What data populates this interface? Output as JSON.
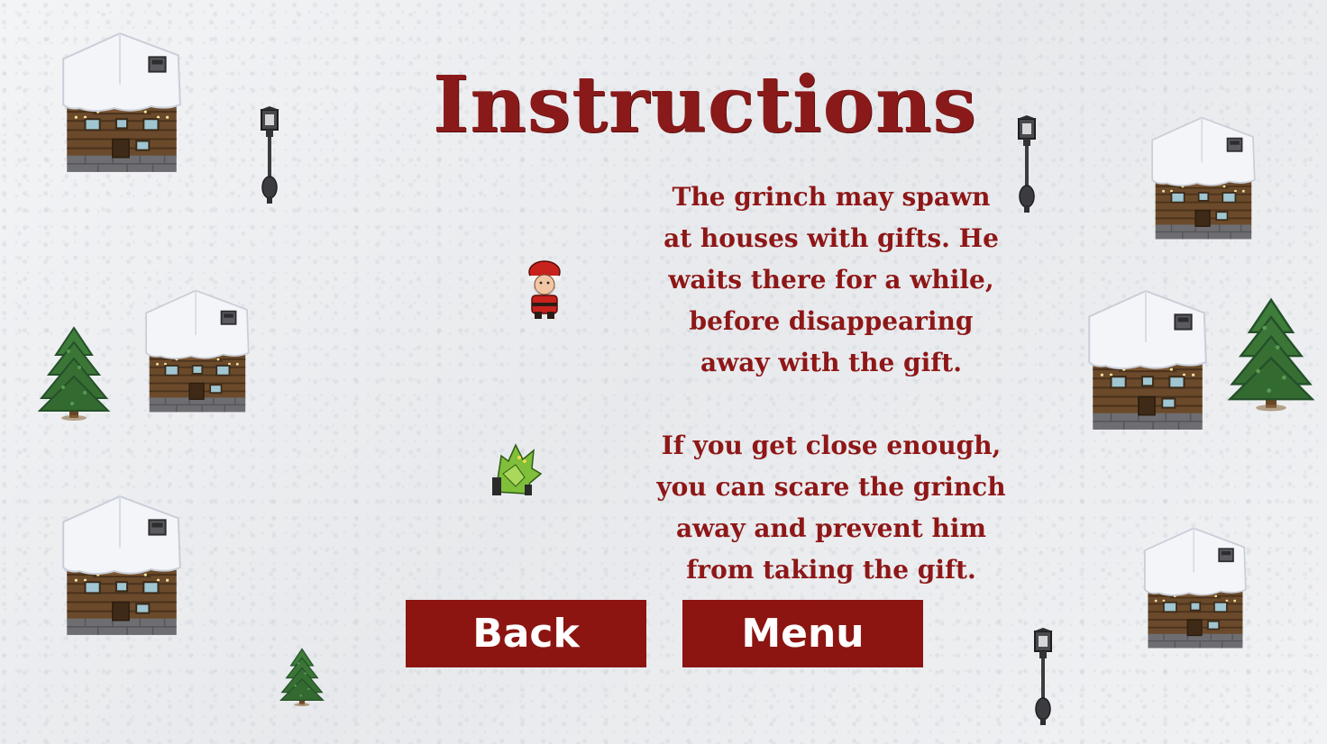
{
  "screen": {
    "title": "Instructions",
    "paragraph_1": "The grinch may spawn at houses with gifts. He waits there for a while, before disappearing away with the gift.",
    "paragraph_2": "If you get close enough, you can scare the grinch away and prevent him from taking the gift."
  },
  "buttons": {
    "back_label": "Back",
    "menu_label": "Menu"
  },
  "colors": {
    "text_red": "#8e1717",
    "button_bg": "#8c1512",
    "button_text": "#ffffff",
    "snow": "#eef0f2"
  },
  "sprites": {
    "house": "snow-roofed-log-cabin",
    "tree": "pine-tree",
    "lamp": "street-lamp",
    "santa": "santa-character",
    "grinch": "grinch-character"
  }
}
